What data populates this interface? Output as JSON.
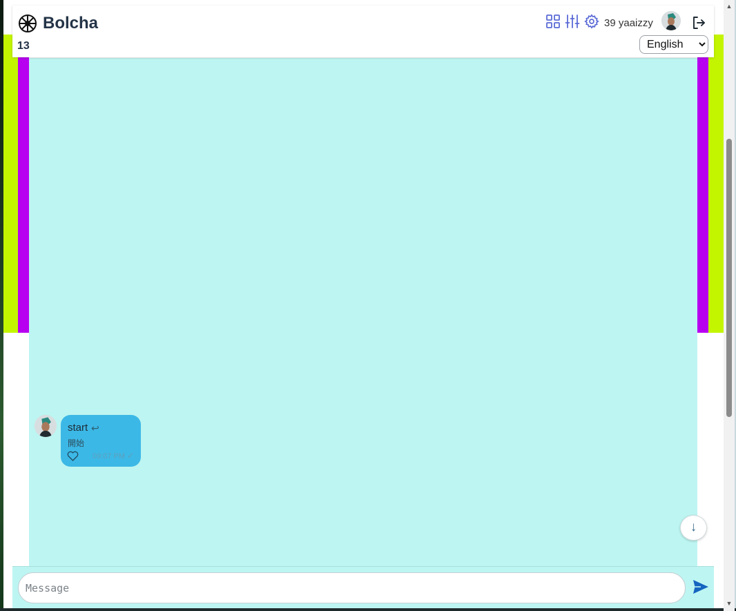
{
  "header": {
    "app_title": "Bolcha",
    "room_count": "13",
    "user_label": "39 yaaizzy",
    "language": {
      "selected": "English",
      "options": [
        "English"
      ]
    },
    "icons": [
      "grid-icon",
      "sliders-icon",
      "gear-icon",
      "logout-icon"
    ]
  },
  "messages": [
    {
      "text": "start",
      "reply_marker": "↩",
      "translation": "開始",
      "time": "09:07 PM",
      "read_mark": "✓"
    }
  ],
  "scroll_down_label": "↓",
  "composer": {
    "placeholder": "Message",
    "value": ""
  },
  "colors": {
    "chat_background": "#bdf5f2",
    "accent_lime": "#c3f500",
    "accent_purple": "#b800f0",
    "bubble": "#3cb8e6",
    "header_icons": "#5b6bd6"
  }
}
